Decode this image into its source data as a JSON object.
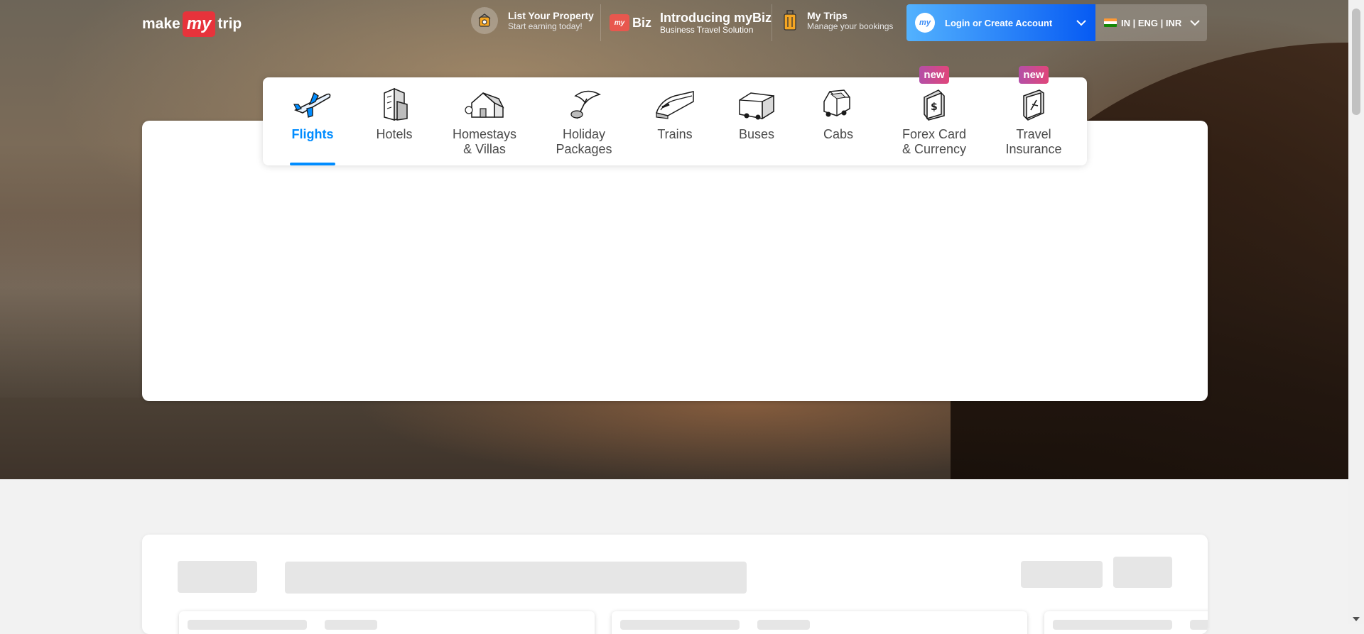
{
  "header": {
    "logo": {
      "make": "make",
      "my": "my",
      "trip": "trip"
    },
    "list_property": {
      "title": "List Your Property",
      "subtitle": "Start earning today!",
      "icon": "house-icon"
    },
    "mybiz": {
      "logo_text": "Biz",
      "logo_badge": "my",
      "title": "Introducing myBiz",
      "subtitle": "Business Travel Solution"
    },
    "my_trips": {
      "title": "My Trips",
      "subtitle": "Manage your bookings",
      "icon": "suitcase-icon"
    },
    "login": {
      "label": "Login or Create Account",
      "avatar_text": "my"
    },
    "locale": {
      "label": "IN | ENG | INR"
    }
  },
  "nav": {
    "items": [
      {
        "label": "Flights",
        "active": true,
        "icon": "airplane-icon"
      },
      {
        "label": "Hotels",
        "icon": "hotel-building-icon"
      },
      {
        "label_line1": "Homestays",
        "label_line2": "& Villas",
        "icon": "house-icon"
      },
      {
        "label_line1": "Holiday",
        "label_line2": "Packages",
        "icon": "beach-umbrella-icon"
      },
      {
        "label": "Trains",
        "icon": "train-icon"
      },
      {
        "label": "Buses",
        "icon": "bus-icon"
      },
      {
        "label": "Cabs",
        "icon": "car-icon"
      },
      {
        "label_line1": "Forex Card",
        "label_line2": "& Currency",
        "badge": "new",
        "icon": "forex-card-icon"
      },
      {
        "label_line1": "Travel",
        "label_line2": "Insurance",
        "badge": "new",
        "icon": "insurance-shield-icon"
      }
    ]
  },
  "colors": {
    "accent": "#008cff",
    "brand_red": "#e7333b",
    "login_gradient_start": "#53b2fe",
    "login_gradient_end": "#065af3"
  }
}
